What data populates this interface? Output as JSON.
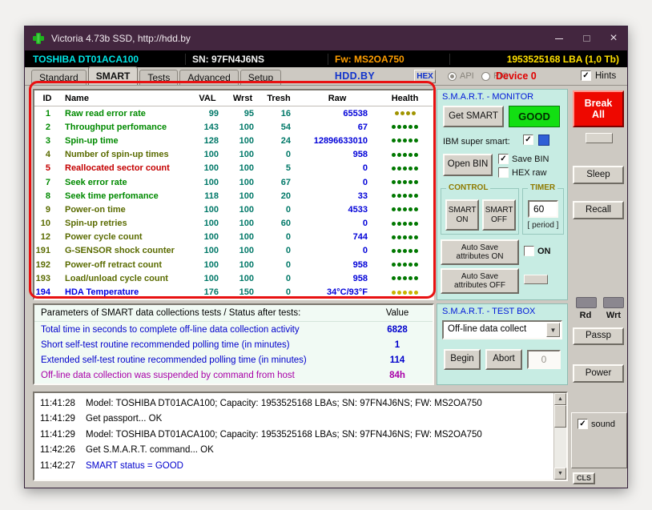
{
  "window": {
    "title": "Victoria 4.73b SSD, http://hdd.by"
  },
  "icons": {
    "app": "green-cross",
    "close": "×",
    "check": "✓",
    "dropdown_arrow": "▼",
    "scroll_up": "▲",
    "scroll_down": "▼"
  },
  "device_bar": {
    "model": "TOSHIBA DT01ACA100",
    "serial": "SN: 97FN4J6NS",
    "firmware": "Fw: MS2OA750",
    "capacity": "1953525168 LBA (1,0 Tb)"
  },
  "tab_bar": {
    "tabs": [
      "Standard",
      "SMART",
      "Tests",
      "Advanced",
      "Setup"
    ],
    "active_tab": "SMART",
    "brand": "HDD.BY",
    "hex_button": "HEX",
    "api_radio": "API",
    "pio_radio": "PIO",
    "device_label": "Device 0",
    "hints_checkbox": "Hints"
  },
  "smart_table": {
    "headers": {
      "id": "ID",
      "name": "Name",
      "val": "VAL",
      "wrst": "Wrst",
      "tresh": "Tresh",
      "raw": "Raw",
      "health": "Health"
    },
    "value_color": "#007868",
    "raw_color": "#0000d8",
    "rows": [
      {
        "id": "1",
        "name": "Raw read error rate",
        "val": "99",
        "wrst": "95",
        "tresh": "16",
        "raw": "65538",
        "color": "#008a00",
        "dots": 4,
        "dot_color": "#a09400"
      },
      {
        "id": "2",
        "name": "Throughput perfomance",
        "val": "143",
        "wrst": "100",
        "tresh": "54",
        "raw": "67",
        "color": "#008a00",
        "dots": 5,
        "dot_color": "#007800"
      },
      {
        "id": "3",
        "name": "Spin-up time",
        "val": "128",
        "wrst": "100",
        "tresh": "24",
        "raw": "12896633010",
        "color": "#008a00",
        "dots": 5,
        "dot_color": "#007800"
      },
      {
        "id": "4",
        "name": "Number of spin-up times",
        "val": "100",
        "wrst": "100",
        "tresh": "0",
        "raw": "958",
        "color": "#5a6b00",
        "dots": 5,
        "dot_color": "#007800"
      },
      {
        "id": "5",
        "name": "Reallocated sector count",
        "val": "100",
        "wrst": "100",
        "tresh": "5",
        "raw": "0",
        "color": "#c40000",
        "dots": 5,
        "dot_color": "#007800"
      },
      {
        "id": "7",
        "name": "Seek error rate",
        "val": "100",
        "wrst": "100",
        "tresh": "67",
        "raw": "0",
        "color": "#008a00",
        "dots": 5,
        "dot_color": "#007800"
      },
      {
        "id": "8",
        "name": "Seek time perfomance",
        "val": "118",
        "wrst": "100",
        "tresh": "20",
        "raw": "33",
        "color": "#008a00",
        "dots": 5,
        "dot_color": "#007800"
      },
      {
        "id": "9",
        "name": "Power-on time",
        "val": "100",
        "wrst": "100",
        "tresh": "0",
        "raw": "4533",
        "color": "#5a6b00",
        "dots": 5,
        "dot_color": "#007800"
      },
      {
        "id": "10",
        "name": "Spin-up retries",
        "val": "100",
        "wrst": "100",
        "tresh": "60",
        "raw": "0",
        "color": "#5a6b00",
        "dots": 5,
        "dot_color": "#007800"
      },
      {
        "id": "12",
        "name": "Power cycle count",
        "val": "100",
        "wrst": "100",
        "tresh": "0",
        "raw": "744",
        "color": "#5a6b00",
        "dots": 5,
        "dot_color": "#007800"
      },
      {
        "id": "191",
        "name": "G-SENSOR shock counter",
        "val": "100",
        "wrst": "100",
        "tresh": "0",
        "raw": "0",
        "color": "#5a6b00",
        "dots": 5,
        "dot_color": "#007800"
      },
      {
        "id": "192",
        "name": "Power-off retract count",
        "val": "100",
        "wrst": "100",
        "tresh": "0",
        "raw": "958",
        "color": "#5a6b00",
        "dots": 5,
        "dot_color": "#007800"
      },
      {
        "id": "193",
        "name": "Load/unload cycle count",
        "val": "100",
        "wrst": "100",
        "tresh": "0",
        "raw": "958",
        "color": "#5a6b00",
        "dots": 5,
        "dot_color": "#007800"
      },
      {
        "id": "194",
        "name": "HDA Temperature",
        "val": "176",
        "wrst": "150",
        "tresh": "0",
        "raw": "34°C/93°F",
        "color": "#0000e0",
        "dots": 5,
        "dot_color": "#c8b400"
      }
    ]
  },
  "monitor_panel": {
    "title": "S.M.A.R.T. - MONITOR",
    "get_smart_button": "Get SMART",
    "status": "GOOD",
    "status_color": "#12df12",
    "ibm_label": "IBM super smart:",
    "open_bin_button": "Open BIN",
    "save_bin_checkbox": "Save BIN",
    "hex_raw_checkbox": "HEX raw",
    "control_group": "CONTROL",
    "timer_group": "TIMER",
    "smart_on_button": "SMART ON",
    "smart_off_button": "SMART OFF",
    "timer_value": "60",
    "period_label": "[ period ]",
    "auto_save_on_button": "Auto Save attributes ON",
    "on_checkbox": "ON",
    "auto_save_off_button": "Auto Save attributes OFF"
  },
  "parameters_panel": {
    "header": "Parameters of SMART data collections tests / Status after tests:",
    "value_header": "Value",
    "rows": [
      {
        "label": "Total time in seconds to complete off-line data collection activity",
        "value": "6828",
        "color": "#0000cc"
      },
      {
        "label": "Short self-test routine recommended polling time (in minutes)",
        "value": "1",
        "color": "#0000cc"
      },
      {
        "label": "Extended self-test routine recommended polling time (in minutes)",
        "value": "114",
        "color": "#0000cc"
      },
      {
        "label": "Off-line data collection was suspended by command from host",
        "value": "84h",
        "color": "#a800a8"
      }
    ]
  },
  "testbox_panel": {
    "title": "S.M.A.R.T. - TEST BOX",
    "test_select": "Off-line data collect",
    "begin_button": "Begin",
    "abort_button": "Abort",
    "count_field": "0"
  },
  "sidebar": {
    "break_all_button": "Break All",
    "sleep_button": "Sleep",
    "recall_button": "Recall",
    "rd_label": "Rd",
    "wrt_label": "Wrt",
    "passp_button": "Passp",
    "power_button": "Power",
    "sound_checkbox": "sound",
    "cls_button": "CLS"
  },
  "log": {
    "entries": [
      {
        "time": "11:41:28",
        "text": "Model: TOSHIBA DT01ACA100; Capacity: 1953525168 LBAs; SN: 97FN4J6NS; FW: MS2OA750",
        "color": "#000000"
      },
      {
        "time": "11:41:29",
        "text": "Get passport... OK",
        "color": "#000000"
      },
      {
        "time": "11:41:29",
        "text": "Model: TOSHIBA DT01ACA100; Capacity: 1953525168 LBAs; SN: 97FN4J6NS; FW: MS2OA750",
        "color": "#000000"
      },
      {
        "time": "11:42:26",
        "text": "Get S.M.A.R.T. command... OK",
        "color": "#000000"
      },
      {
        "time": "11:42:27",
        "text": "SMART status = GOOD",
        "color": "#0000cc"
      }
    ]
  }
}
